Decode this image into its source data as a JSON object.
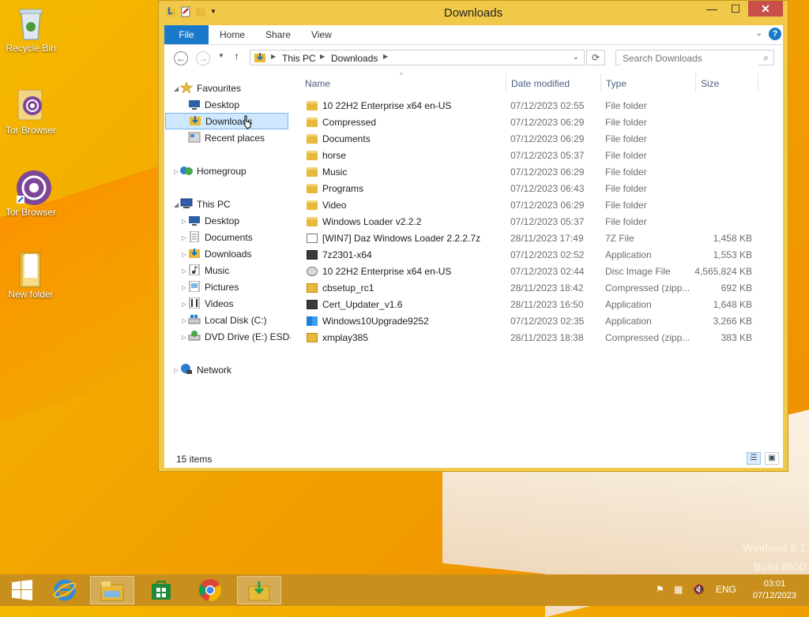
{
  "desktop": {
    "icons": [
      {
        "label": "Recycle Bin"
      },
      {
        "label": "Tor Browser"
      },
      {
        "label": "Tor Browser"
      },
      {
        "label": "New folder"
      }
    ],
    "watermark_line1": "Windows 8.1",
    "watermark_line2": "Build 9600"
  },
  "window": {
    "title": "Downloads",
    "ribbon_tabs": [
      "File",
      "Home",
      "Share",
      "View"
    ],
    "address": {
      "crumbs": [
        "This PC",
        "Downloads"
      ]
    },
    "search_placeholder": "Search Downloads"
  },
  "navpane": {
    "favourites": "Favourites",
    "fav_items": [
      "Desktop",
      "Downloads",
      "Recent places"
    ],
    "homegroup": "Homegroup",
    "this_pc": "This PC",
    "pc_items": [
      "Desktop",
      "Documents",
      "Downloads",
      "Music",
      "Pictures",
      "Videos",
      "Local Disk (C:)",
      "DVD Drive (E:) ESD-IS"
    ],
    "network": "Network"
  },
  "filelist": {
    "columns": {
      "name": "Name",
      "date": "Date modified",
      "type": "Type",
      "size": "Size"
    },
    "rows": [
      {
        "name": "10 22H2 Enterprise x64 en-US",
        "date": "07/12/2023 02:55",
        "type": "File folder",
        "size": "",
        "icon": "folder-icon"
      },
      {
        "name": "Compressed",
        "date": "07/12/2023 06:29",
        "type": "File folder",
        "size": "",
        "icon": "folder-icon"
      },
      {
        "name": "Documents",
        "date": "07/12/2023 06:29",
        "type": "File folder",
        "size": "",
        "icon": "folder-icon"
      },
      {
        "name": "horse",
        "date": "07/12/2023 05:37",
        "type": "File folder",
        "size": "",
        "icon": "folder-icon"
      },
      {
        "name": "Music",
        "date": "07/12/2023 06:29",
        "type": "File folder",
        "size": "",
        "icon": "folder-icon"
      },
      {
        "name": "Programs",
        "date": "07/12/2023 06:43",
        "type": "File folder",
        "size": "",
        "icon": "folder-icon"
      },
      {
        "name": "Video",
        "date": "07/12/2023 06:29",
        "type": "File folder",
        "size": "",
        "icon": "folder-icon"
      },
      {
        "name": "Windows Loader v2.2.2",
        "date": "07/12/2023 05:37",
        "type": "File folder",
        "size": "",
        "icon": "folder-icon"
      },
      {
        "name": "[WIN7] Daz Windows Loader 2.2.2.7z",
        "date": "28/11/2023 17:49",
        "type": "7Z File",
        "size": "1,458 KB",
        "icon": "document-icon"
      },
      {
        "name": "7z2301-x64",
        "date": "07/12/2023 02:52",
        "type": "Application",
        "size": "1,553 KB",
        "icon": "application-icon"
      },
      {
        "name": "10 22H2 Enterprise x64 en-US",
        "date": "07/12/2023 02:44",
        "type": "Disc Image File",
        "size": "4,565,824 KB",
        "icon": "disc-image-icon"
      },
      {
        "name": "cbsetup_rc1",
        "date": "28/11/2023 18:42",
        "type": "Compressed (zipp...",
        "size": "692 KB",
        "icon": "zip-icon"
      },
      {
        "name": "Cert_Updater_v1.6",
        "date": "28/11/2023 16:50",
        "type": "Application",
        "size": "1,648 KB",
        "icon": "application-icon"
      },
      {
        "name": "Windows10Upgrade9252",
        "date": "07/12/2023 02:35",
        "type": "Application",
        "size": "3,266 KB",
        "icon": "windows-icon"
      },
      {
        "name": "xmplay385",
        "date": "28/11/2023 18:38",
        "type": "Compressed (zipp...",
        "size": "383 KB",
        "icon": "zip-icon"
      }
    ]
  },
  "status": {
    "items_count": "15 items"
  },
  "taskbar": {
    "language": "ENG",
    "time": "03:01",
    "date": "07/12/2023"
  },
  "colors": {
    "accent": "#1979ca",
    "selection": "#cde8ff",
    "window_frame": "#f1c94a"
  }
}
